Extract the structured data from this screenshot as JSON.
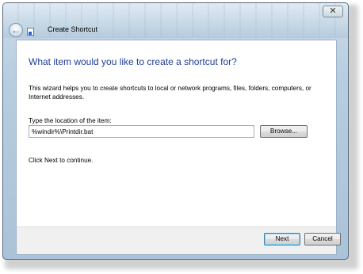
{
  "window": {
    "title": "Create Shortcut",
    "close_label": "✕",
    "back_glyph": "←",
    "icons": [
      "back-arrow-icon",
      "shortcut-icon",
      "close-icon"
    ]
  },
  "wizard": {
    "heading": "What item would you like to create a shortcut for?",
    "description": "This wizard helps you to create shortcuts to local or network programs, files, folders, computers, or Internet addresses.",
    "location_label": "Type the location of the item:",
    "location_value": "%windir%\\Printdir.bat",
    "browse_label": "Browse...",
    "continue_hint": "Click Next to continue."
  },
  "footer": {
    "next_label": "Next",
    "cancel_label": "Cancel"
  },
  "colors": {
    "heading": "#1f3f99",
    "chrome": "#b7cde0"
  }
}
